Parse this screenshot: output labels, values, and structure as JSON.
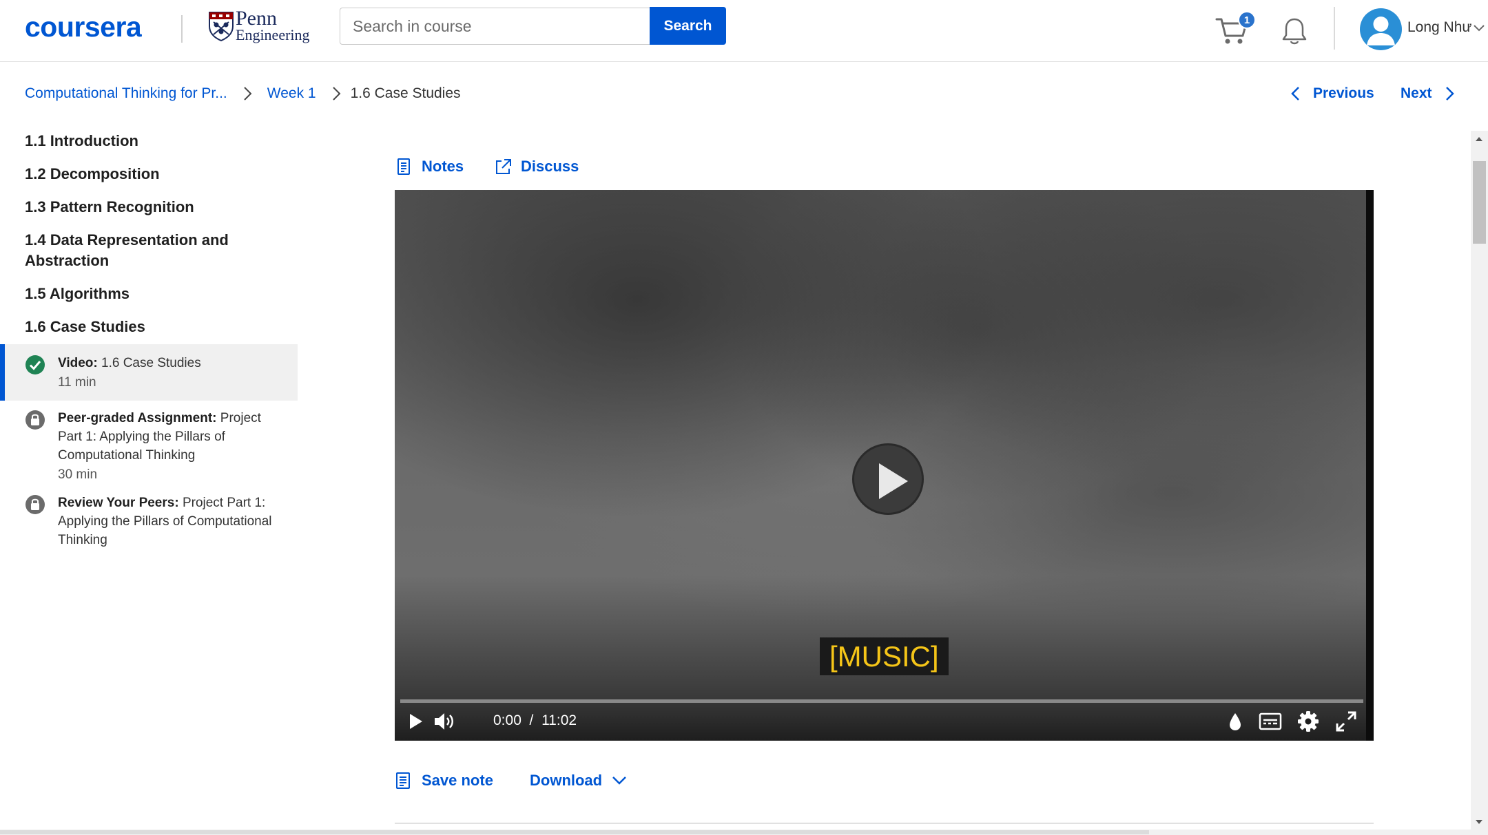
{
  "header": {
    "brand": "coursera",
    "partner_line1": "Penn",
    "partner_line2": "Engineering",
    "search_placeholder": "Search in course",
    "search_button": "Search",
    "cart_count": "1",
    "user_name": "Long Như"
  },
  "breadcrumb": {
    "course": "Computational Thinking for Pr...",
    "week": "Week 1",
    "current": "1.6 Case Studies"
  },
  "nav": {
    "previous": "Previous",
    "next": "Next"
  },
  "sidebar": {
    "lessons": [
      "1.1 Introduction",
      "1.2 Decomposition",
      "1.3 Pattern Recognition",
      "1.4 Data Representation and Abstraction",
      "1.5 Algorithms",
      "1.6 Case Studies"
    ],
    "items": [
      {
        "type": "Video:",
        "title": "1.6 Case Studies",
        "meta": "11 min",
        "status": "completed"
      },
      {
        "type": "Peer-graded Assignment:",
        "title": "Project Part 1: Applying the Pillars of Computational Thinking",
        "meta": "30 min",
        "status": "locked"
      },
      {
        "type": "Review Your Peers:",
        "title": "Project Part 1: Applying the Pillars of Computational Thinking",
        "meta": "",
        "status": "locked"
      }
    ]
  },
  "main": {
    "notes": "Notes",
    "discuss": "Discuss",
    "save_note": "Save note",
    "download": "Download"
  },
  "video": {
    "caption": "[MUSIC]",
    "current_time": "0:00",
    "separator": "/",
    "duration": "11:02",
    "progress": 0
  },
  "colors": {
    "accent": "#0056d2",
    "completed": "#1f8354",
    "locked": "#6b6b6b",
    "caption_text": "#f5c518"
  }
}
